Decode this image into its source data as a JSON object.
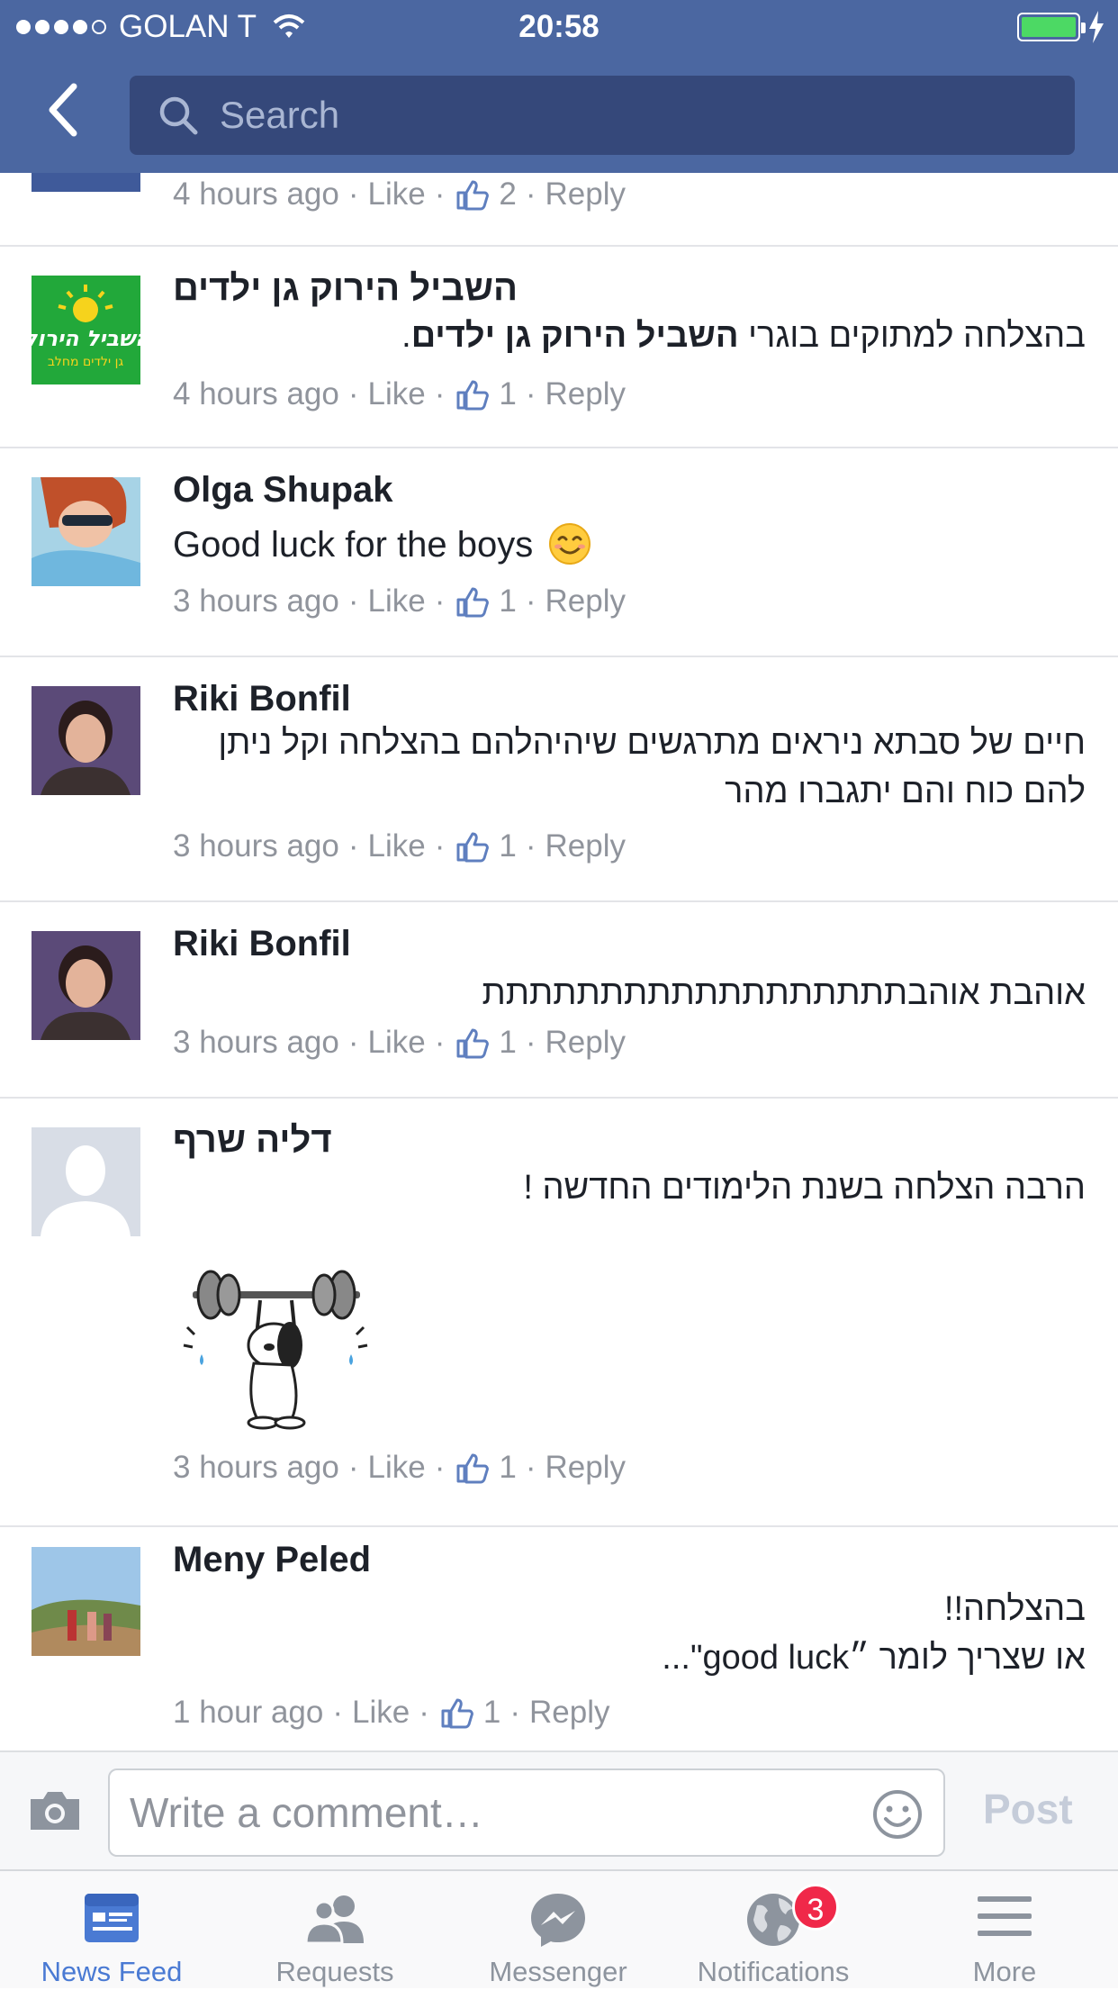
{
  "status_bar": {
    "carrier": "GOLAN T",
    "time": "20:58"
  },
  "search": {
    "placeholder": "Search"
  },
  "partial_comment": {
    "time": "4 hours ago",
    "like": "Like",
    "likes": "2",
    "reply": "Reply"
  },
  "comments": [
    {
      "name": "השביל הירוק גן ילדים",
      "text_prefix": "בהצלחה למתוקים בוגרי ",
      "text_bold": "השביל הירוק גן ילדים",
      "text_suffix": ".",
      "time": "4 hours ago",
      "like": "Like",
      "likes": "1",
      "reply": "Reply",
      "avatar_text": "השביל הירוק",
      "avatar_subtext": "גן ילדים מחלב"
    },
    {
      "name": "Olga Shupak",
      "text": "Good luck for the boys",
      "time": "3 hours ago",
      "like": "Like",
      "likes": "1",
      "reply": "Reply"
    },
    {
      "name": "Riki Bonfil",
      "text": "חיים של סבתא ניראים מתרגשים שיהיהלהם  בהצלחה וקל ניתן להם כוח והם יתגברו מהר",
      "time": "3 hours ago",
      "like": "Like",
      "likes": "1",
      "reply": "Reply"
    },
    {
      "name": "Riki Bonfil",
      "text": "אוהבת אוהבתתתתתתתתתתתתתתתתתת",
      "time": "3 hours ago",
      "like": "Like",
      "likes": "1",
      "reply": "Reply"
    },
    {
      "name": "דליה שרף",
      "text": "הרבה הצלחה בשנת הלימודים החדשה !",
      "time": "3 hours ago",
      "like": "Like",
      "likes": "1",
      "reply": "Reply"
    },
    {
      "name": "Meny Peled",
      "text_line1": "בהצלחה!!",
      "text_line2": "או שצריך לומר ״good luck\"...",
      "time": "1 hour ago",
      "like": "Like",
      "likes": "1",
      "reply": "Reply"
    }
  ],
  "composer": {
    "placeholder": "Write a comment…",
    "post_label": "Post"
  },
  "tabs": [
    {
      "label": "News Feed",
      "icon": "news-feed-icon",
      "active": true
    },
    {
      "label": "Requests",
      "icon": "friend-requests-icon"
    },
    {
      "label": "Messenger",
      "icon": "messenger-icon"
    },
    {
      "label": "Notifications",
      "icon": "globe-icon",
      "badge": "3"
    },
    {
      "label": "More",
      "icon": "hamburger-icon"
    }
  ],
  "colors": {
    "header": "#4b67a1",
    "search_bg": "#35487a",
    "active_tab": "#4a7ad3",
    "badge": "#f02849",
    "meta_text": "#90949c"
  }
}
